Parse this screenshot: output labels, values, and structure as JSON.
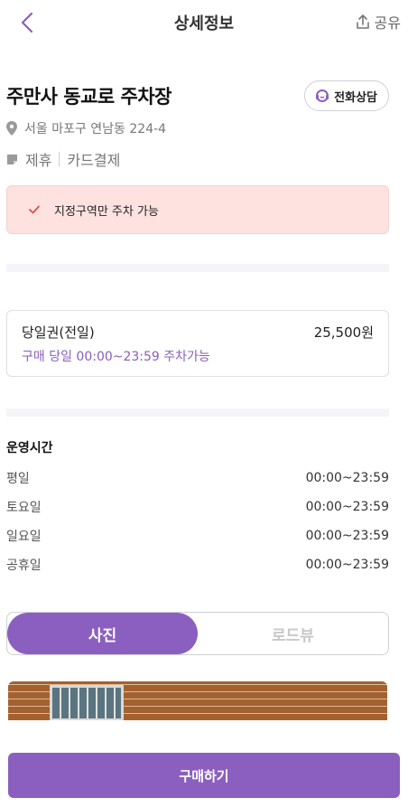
{
  "header": {
    "title": "상세정보",
    "share_label": "공유"
  },
  "lot": {
    "name": "주만사 동교로 주차장",
    "call_label": "전화상담",
    "address": "서울 마포구 연남동 224-4",
    "tags": [
      "제휴",
      "카드결제"
    ]
  },
  "notice": {
    "text": "지정구역만 주차 가능"
  },
  "ticket": {
    "name": "당일권(전일)",
    "price": "25,500원",
    "description": "구매 당일 00:00~23:59 주차가능"
  },
  "hours": {
    "title": "운영시간",
    "rows": [
      {
        "day": "평일",
        "time": "00:00~23:59"
      },
      {
        "day": "토요일",
        "time": "00:00~23:59"
      },
      {
        "day": "일요일",
        "time": "00:00~23:59"
      },
      {
        "day": "공휴일",
        "time": "00:00~23:59"
      }
    ]
  },
  "tabs": [
    {
      "label": "사진",
      "active": true
    },
    {
      "label": "로드뷰",
      "active": false
    }
  ],
  "buy": {
    "label": "구매하기"
  },
  "colors": {
    "accent": "#8b5fbf",
    "notice_bg": "#fde2df",
    "notice_check": "#d9534f"
  }
}
